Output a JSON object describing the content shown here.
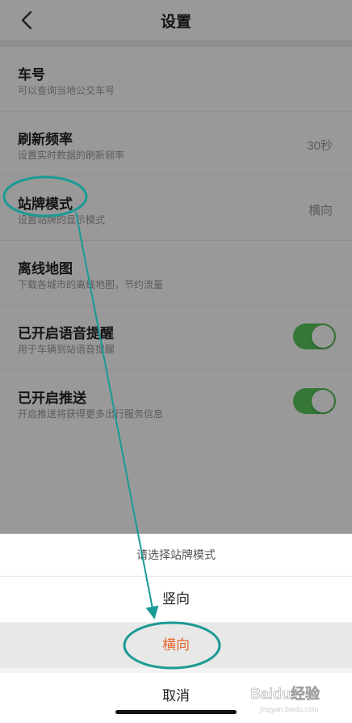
{
  "header": {
    "title": "设置"
  },
  "settings": [
    {
      "title": "车号",
      "desc": "可以查询当地公交车号",
      "value": ""
    },
    {
      "title": "刷新频率",
      "desc": "设置实时数据的刷新频率",
      "value": "30秒"
    },
    {
      "title": "站牌模式",
      "desc": "设置站牌的显示模式",
      "value": "横向"
    },
    {
      "title": "离线地图",
      "desc": "下载各城市的离线地图，节约流量",
      "value": ""
    },
    {
      "title": "已开启语音提醒",
      "desc": "用于车辆到站语音提醒",
      "toggle": true
    },
    {
      "title": "已开启推送",
      "desc": "开启推送将获得更多出行服务信息",
      "toggle": true
    }
  ],
  "sheet": {
    "title": "请选择站牌模式",
    "options": [
      "竖向",
      "横向"
    ],
    "selected": "横向",
    "cancel": "取消"
  },
  "colors": {
    "toggle_on": "#57c65a",
    "selected_text": "#e8632c",
    "annotation": "#1a9a94"
  },
  "watermark": {
    "logo": "Baidu经验",
    "url": "jingyan.baidu.com"
  }
}
